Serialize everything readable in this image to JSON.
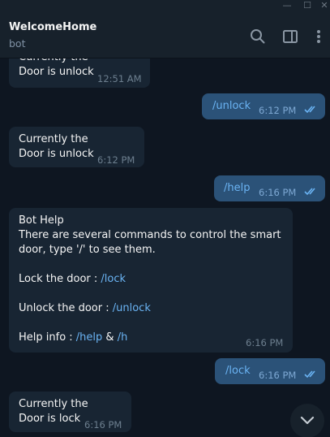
{
  "window": {
    "minimize_glyph": "—",
    "maximize_glyph": "☐",
    "close_glyph": "✕"
  },
  "header": {
    "title": "WelcomeHome",
    "subtitle": "bot",
    "icons": [
      "search-icon",
      "sidebar-toggle-icon",
      "more-vert-icon"
    ]
  },
  "messages": [
    {
      "direction": "in",
      "lines": [
        "Currently the",
        "Door is unlock"
      ],
      "time": "12:51 AM"
    },
    {
      "direction": "out",
      "text": "/unlock",
      "time": "6:12 PM",
      "read": true
    },
    {
      "direction": "in",
      "lines": [
        "Currently the",
        "Door is unlock"
      ],
      "time": "6:12 PM"
    },
    {
      "direction": "out",
      "text": "/help",
      "time": "6:16 PM",
      "read": true
    },
    {
      "direction": "in",
      "title": "Bot Help",
      "intro_1": "There are several commands to control the smart",
      "intro_2": "door, type '/' to see them.",
      "lock_label": "Lock the door : ",
      "lock_cmd": "/lock",
      "unlock_label": "Unlock the door : ",
      "unlock_cmd": "/unlock",
      "help_label": "Help info : ",
      "help_cmd": "/help",
      "amp": " & ",
      "h_cmd": "/h",
      "time": "6:16 PM"
    },
    {
      "direction": "out",
      "text": "/lock",
      "time": "6:16 PM",
      "read": true
    },
    {
      "direction": "in",
      "lines": [
        "Currently the",
        "Door is lock"
      ],
      "time": "6:16 PM"
    }
  ],
  "scroll_down": {
    "icon": "chevron-down-icon"
  },
  "colors": {
    "background": "#0e1621",
    "incoming_bubble": "#182533",
    "outgoing_bubble": "#2b5278",
    "link": "#6ab3f3",
    "read_ticks": "#6ab3f3"
  }
}
